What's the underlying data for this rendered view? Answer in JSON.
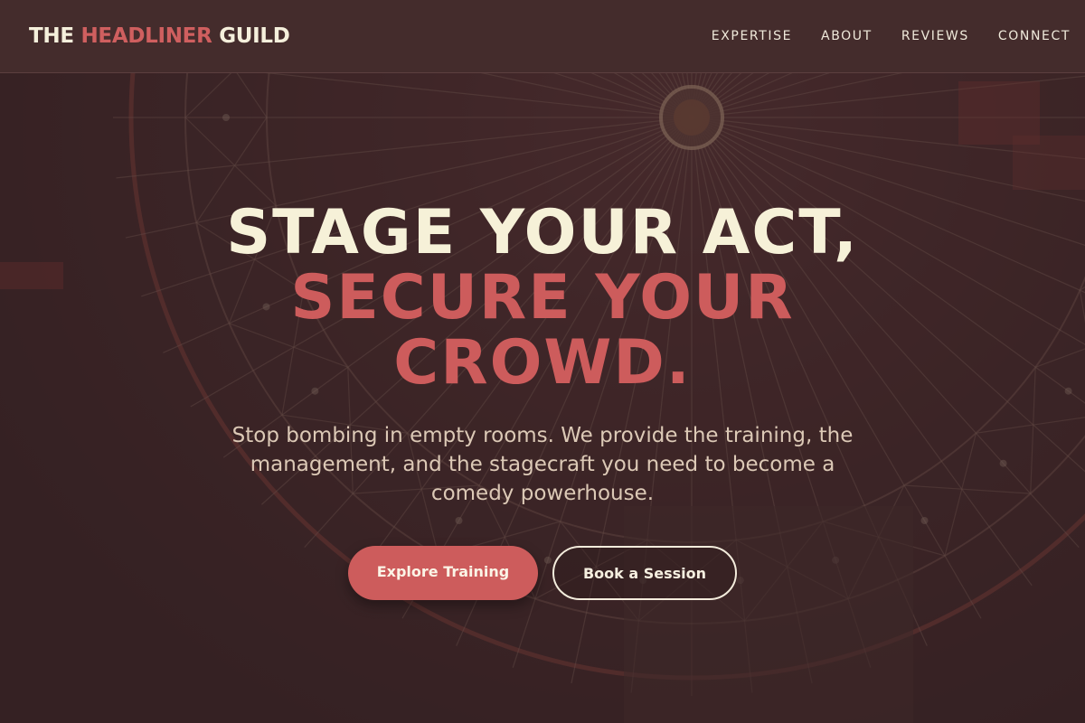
{
  "header": {
    "logo_part1": "THE ",
    "logo_accent": "HEADLINER",
    "logo_part2": " GUILD",
    "nav": [
      {
        "label": "EXPERTISE"
      },
      {
        "label": "ABOUT"
      },
      {
        "label": "REVIEWS"
      },
      {
        "label": "CONNECT"
      }
    ]
  },
  "hero": {
    "headline_line1": "STAGE YOUR ACT,",
    "headline_line2": "SECURE YOUR CROWD.",
    "subtitle": "Stop bombing in empty rooms. We provide the training, the management, and the stagecraft you need to become a comedy powerhouse.",
    "primary_cta": "Explore Training",
    "secondary_cta": "Book a Session"
  },
  "colors": {
    "accent": "#cd5c5c",
    "background": "#3a2426",
    "header_background": "#442c2c",
    "headline_text": "#f6f1d8"
  }
}
